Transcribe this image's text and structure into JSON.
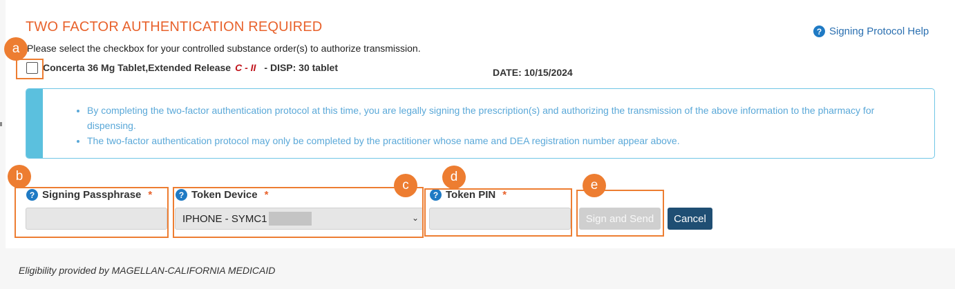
{
  "header": {
    "title": "TWO FACTOR AUTHENTICATION REQUIRED",
    "help_link": "Signing Protocol Help",
    "instructions": "Please select the checkbox for your controlled substance order(s) to authorize transmission."
  },
  "order": {
    "checked": false,
    "medication": "Concerta 36 Mg Tablet,Extended Release",
    "schedule": "C - II",
    "dispense": "- DISP: 30 tablet",
    "date": "DATE: 10/15/2024"
  },
  "notice": {
    "items": [
      "By completing the two-factor authentication protocol at this time, you are legally signing the prescription(s) and authorizing the transmission of the above information to the pharmacy for dispensing.",
      "The two-factor authentication protocol may only be completed by the practitioner whose name and DEA registration number appear above."
    ]
  },
  "form": {
    "passphrase_label": "Signing Passphrase",
    "passphrase_value": "",
    "token_device_label": "Token Device",
    "token_device_value": "IPHONE - SYMC1",
    "token_pin_label": "Token PIN",
    "token_pin_value": "",
    "required_mark": "*",
    "sign_button": "Sign and Send",
    "cancel_button": "Cancel"
  },
  "annotations": {
    "a": "a",
    "b": "b",
    "c": "c",
    "d": "d",
    "e": "e"
  },
  "footer": {
    "eligibility": "Eligibility provided by MAGELLAN-CALIFORNIA MEDICAID"
  },
  "colors": {
    "title": "#e8622c",
    "annotation": "#ed7d31",
    "info_text": "#5aa8d8",
    "cancel_bg": "#1f4e73"
  }
}
